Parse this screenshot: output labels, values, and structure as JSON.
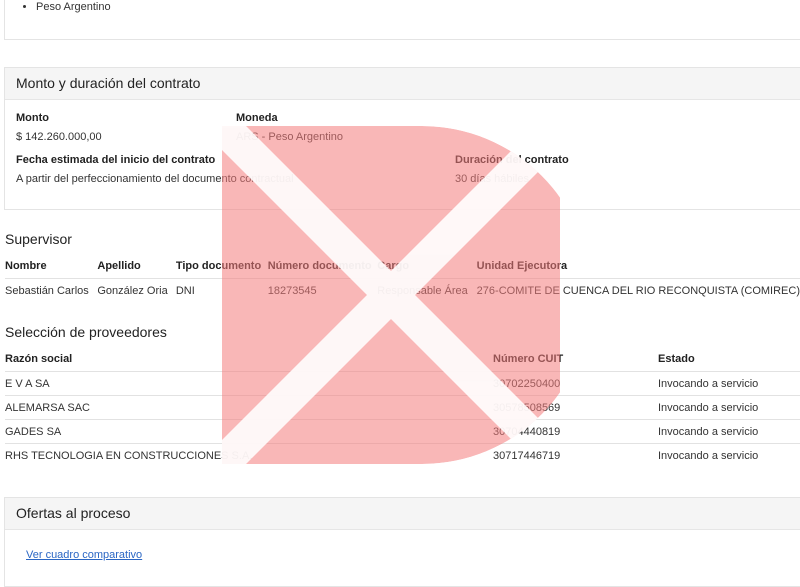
{
  "currency_list": {
    "items": [
      "Peso Argentino"
    ]
  },
  "monto_section": {
    "title": "Monto y duración del contrato",
    "monto_label": "Monto",
    "monto_value": "$ 142.260.000,00",
    "moneda_label": "Moneda",
    "moneda_value": "ARS - Peso Argentino",
    "inicio_label": "Fecha estimada del inicio del contrato",
    "inicio_value": "A partir del perfeccionamiento del documento contractual",
    "duracion_label": "Duración del contrato",
    "duracion_value": "30 días hábiles"
  },
  "supervisor": {
    "title": "Supervisor",
    "headers": [
      "Nombre",
      "Apellido",
      "Tipo documento",
      "Número documento",
      "Cargo",
      "Unidad Ejecutora"
    ],
    "rows": [
      [
        "Sebastián Carlos",
        "González Oria",
        "DNI",
        "18273545",
        "Responsable Área",
        "276-COMITE DE CUENCA DEL RIO RECONQUISTA (COMIREC)"
      ]
    ]
  },
  "proveedores": {
    "title": "Selección de proveedores",
    "headers": [
      "Razón social",
      "Número CUIT",
      "Estado"
    ],
    "rows": [
      [
        "E V A SA",
        "30702250400",
        "Invocando a servicio"
      ],
      [
        "ALEMARSA SAC",
        "30578508569",
        "Invocando a servicio"
      ],
      [
        "GADES SA",
        "30704440819",
        "Invocando a servicio"
      ],
      [
        "RHS TECNOLOGIA EN CONSTRUCCIONES S.A.",
        "30717446719",
        "Invocando a servicio"
      ]
    ]
  },
  "ofertas": {
    "title": "Ofertas al proceso",
    "link_label": "Ver cuadro comparativo"
  },
  "colors": {
    "watermark": "#f47c7c",
    "link": "#2a66c4",
    "header_bg": "#f5f5f5"
  },
  "icons": {
    "watermark": "watermark-logo-icon"
  }
}
